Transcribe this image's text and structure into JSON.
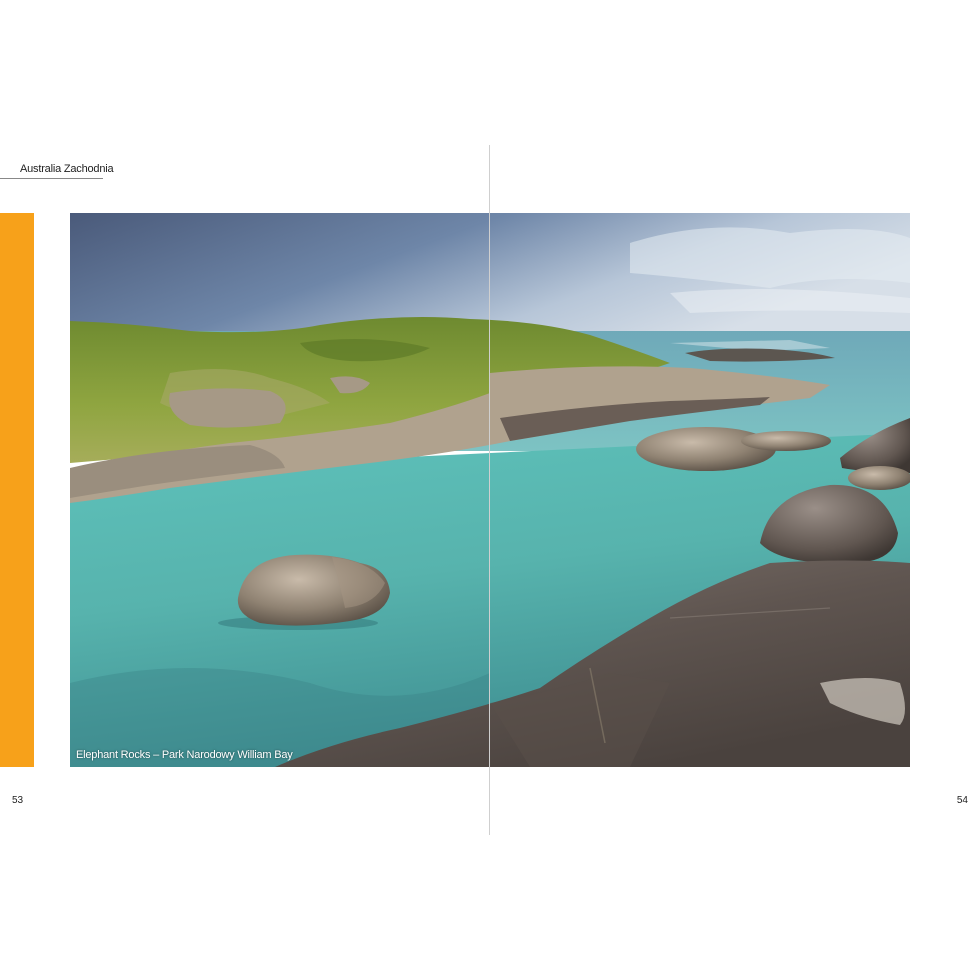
{
  "header": {
    "section_title": "Australia Zachodnia"
  },
  "photo": {
    "caption": "Elephant Rocks – Park Narodowy William Bay"
  },
  "footer": {
    "page_left": "53",
    "page_right": "54"
  },
  "colors": {
    "accent": "#f7a11a",
    "water": "#5fbcb5",
    "rock": "#6e625c",
    "hill": "#7f9a3a"
  }
}
